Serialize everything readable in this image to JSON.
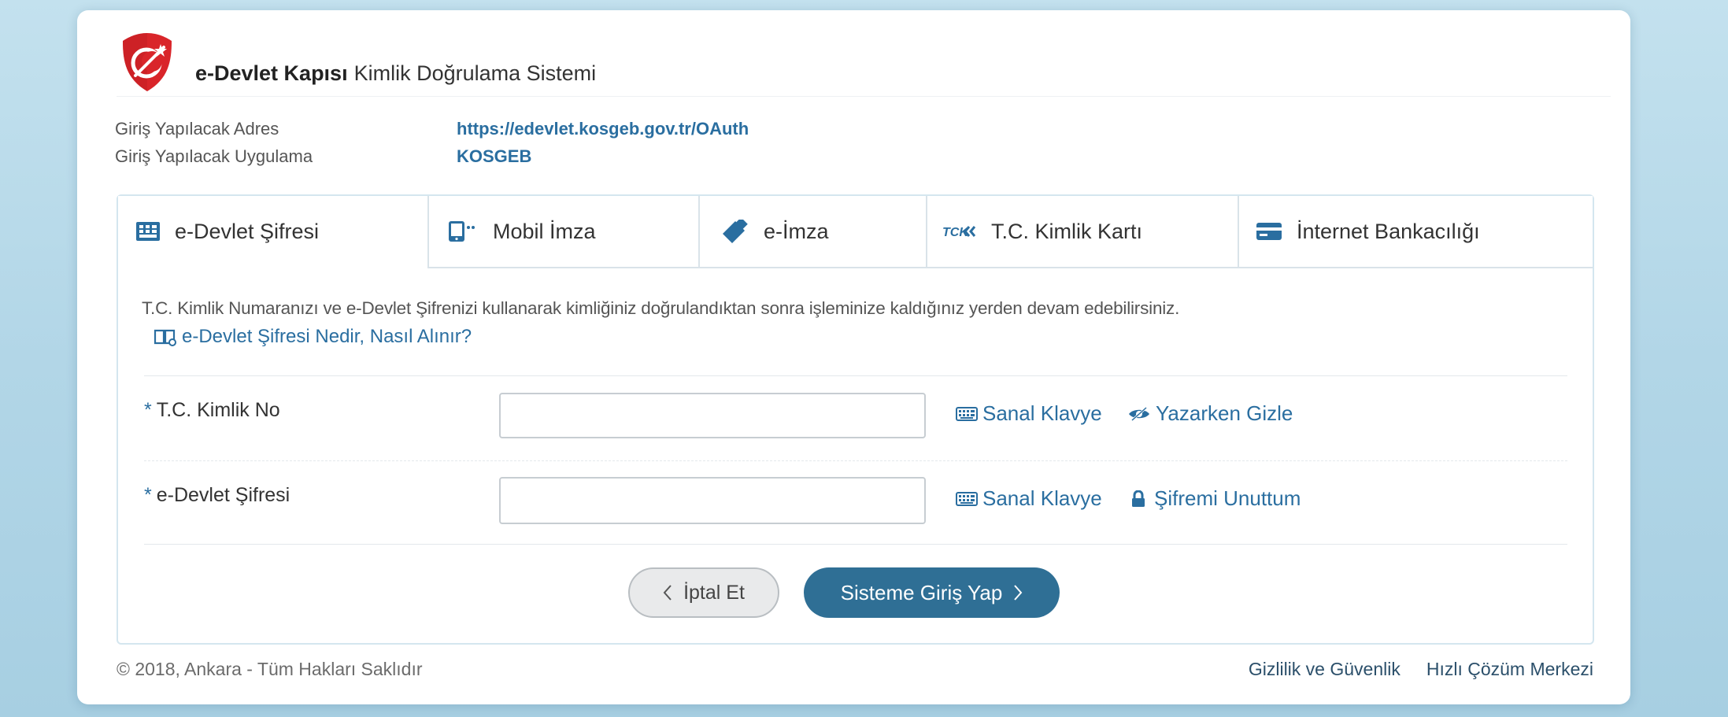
{
  "header": {
    "brand_bold": "e-Devlet Kapısı",
    "brand_rest": "Kimlik Doğrulama Sistemi"
  },
  "info": {
    "address_label": "Giriş Yapılacak Adres",
    "address_value": "https://edevlet.kosgeb.gov.tr/OAuth",
    "app_label": "Giriş Yapılacak Uygulama",
    "app_value": "KOSGEB"
  },
  "tabs": [
    {
      "label": "e-Devlet Şifresi",
      "icon": "keypad-icon",
      "active": true
    },
    {
      "label": "Mobil İmza",
      "icon": "mobile-signature-icon"
    },
    {
      "label": "e-İmza",
      "icon": "usb-token-icon"
    },
    {
      "label": "T.C. Kimlik Kartı",
      "icon": "id-card-icon"
    },
    {
      "label": "İnternet Bankacılığı",
      "icon": "credit-card-icon"
    }
  ],
  "content": {
    "description": "T.C. Kimlik Numaranızı ve e-Devlet Şifrenizi kullanarak kimliğiniz doğrulandıktan sonra işleminize kaldığınız yerden devam edebilirsiniz.",
    "help_link": "e-Devlet Şifresi Nedir, Nasıl Alınır?"
  },
  "form": {
    "star": "*",
    "tc_label": "T.C. Kimlik No",
    "tc_value": "",
    "password_label": "e-Devlet Şifresi",
    "password_value": "",
    "virtual_keyboard": "Sanal Klavye",
    "hide_typing": "Yazarken Gizle",
    "forgot_password": "Şifremi Unuttum"
  },
  "buttons": {
    "cancel": "İptal Et",
    "login": "Sisteme Giriş Yap"
  },
  "footer": {
    "copyright": "© 2018, Ankara - Tüm Hakları Saklıdır",
    "privacy": "Gizlilik ve Güvenlik",
    "help_center": "Hızlı Çözüm Merkezi"
  },
  "colors": {
    "accent": "#2a6ea0",
    "button": "#2f6f95",
    "logo_red": "#d9252a"
  }
}
